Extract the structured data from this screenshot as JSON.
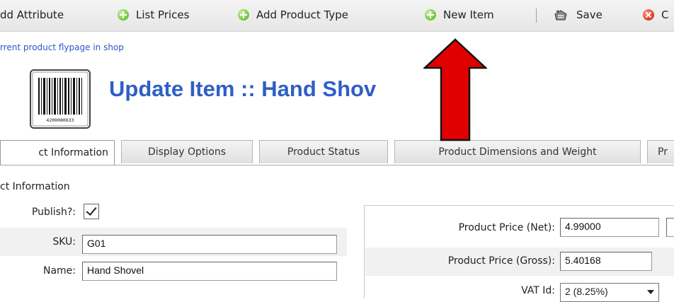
{
  "toolbar": {
    "add_attribute": "dd Attribute",
    "list_prices": "List Prices",
    "add_product_type": "Add Product Type",
    "new_item": "New Item",
    "save": "Save",
    "cancel": "C"
  },
  "flypage_link": "rrent product flypage in shop",
  "page_title": "Update Item :: Hand Shov",
  "tabs": [
    {
      "label": "ct Information"
    },
    {
      "label": "Display Options"
    },
    {
      "label": "Product Status"
    },
    {
      "label": "Product Dimensions and Weight"
    },
    {
      "label": "Pr"
    }
  ],
  "form": {
    "section_title": "ct Information",
    "publish_label": "Publish?:",
    "publish_checked": true,
    "sku_label": "SKU:",
    "sku_value": "G01",
    "name_label": "Name:",
    "name_value": "Hand Shovel"
  },
  "pricing": {
    "net_label": "Product Price (Net):",
    "net_value": "4.99000",
    "gross_label": "Product Price (Gross):",
    "gross_value": "5.40168",
    "vat_label": "VAT Id:",
    "vat_value": "2 (8.25%)"
  },
  "barcode_digits": "4200080633",
  "colors": {
    "title_blue": "#2f5fc6",
    "link_blue": "#2956c8",
    "annotation_arrow": "#e10000"
  }
}
